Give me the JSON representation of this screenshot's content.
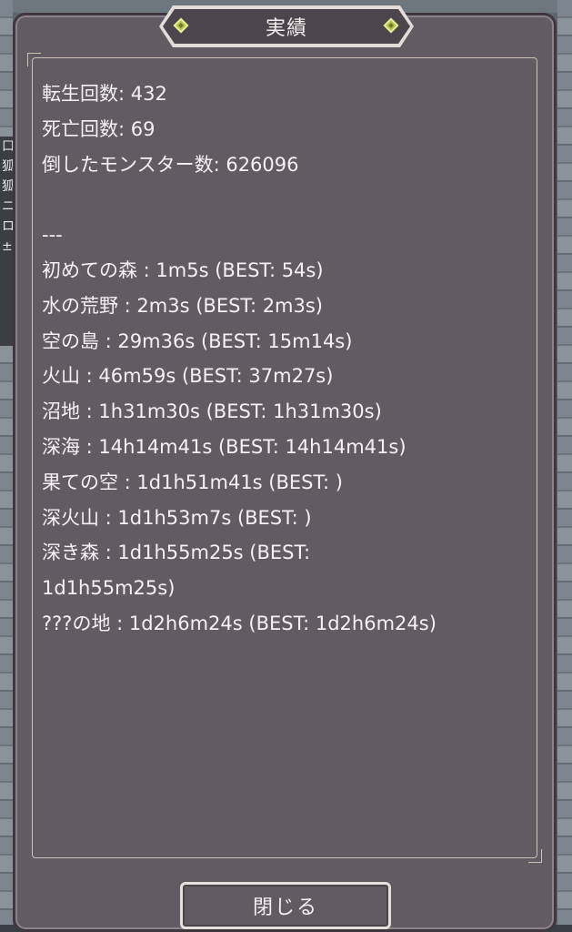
{
  "window": {
    "title": "実績"
  },
  "stats": {
    "rebirth_count": "転生回数: 432",
    "death_count": "死亡回数: 69",
    "monsters_defeated": "倒したモンスター数: 626096"
  },
  "separator": "---",
  "stage_times": [
    "初めての森 : 1m5s (BEST: 54s)",
    "水の荒野 : 2m3s (BEST: 2m3s)",
    "空の島 : 29m36s (BEST: 15m14s)",
    "火山 : 46m59s (BEST: 37m27s)",
    "沼地 : 1h31m30s (BEST: 1h31m30s)",
    "深海 : 14h14m41s (BEST: 14h14m41s)",
    "果ての空 : 1d1h51m41s (BEST: )",
    "深火山 : 1d1h53m7s (BEST: )",
    "深き森 : 1d1h55m25s (BEST:",
    "1d1h55m25s)",
    "???の地 : 1d2h6m24s (BEST: 1d2h6m24s)"
  ],
  "background_glyphs": [
    "口",
    "狐",
    "狐",
    "ニ",
    "ロ",
    "±"
  ],
  "close_button": {
    "label": "閉じる"
  },
  "colors": {
    "panel": "#625b62",
    "text": "#f4f2f2",
    "frame": "#cbbfb7",
    "gem": "#b6c04a"
  }
}
